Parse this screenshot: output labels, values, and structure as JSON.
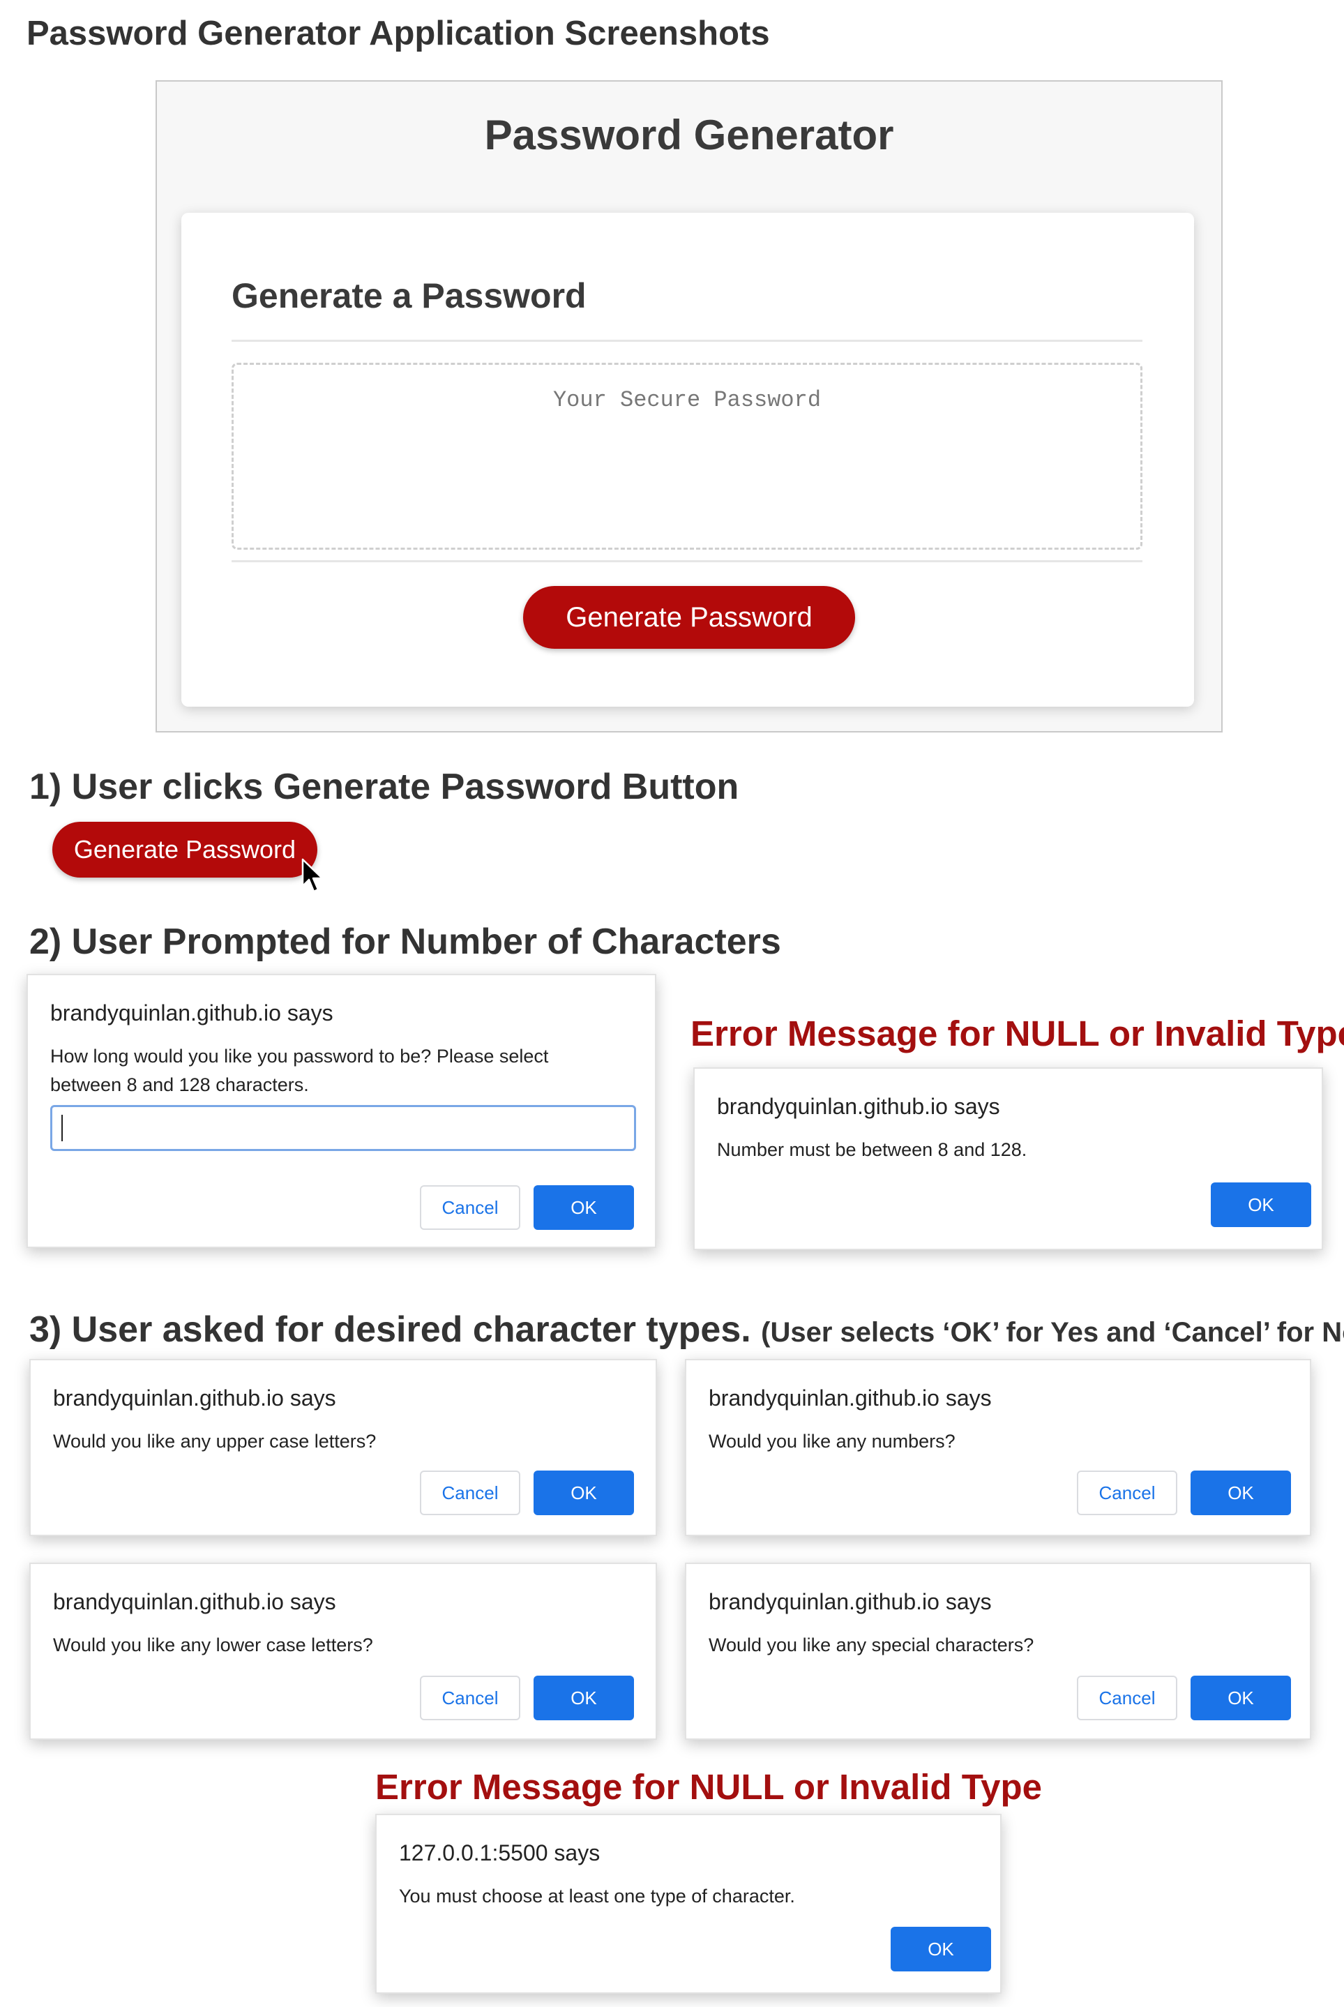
{
  "page_title": "Password Generator Application Screenshots",
  "app": {
    "title": "Password Generator",
    "card_heading": "Generate a Password",
    "password_placeholder": "Your Secure Password",
    "generate_button": "Generate Password"
  },
  "step1": {
    "heading": "1) User clicks Generate Password Button",
    "button_label": "Generate Password"
  },
  "step2": {
    "heading": "2) User Prompted for Number of Characters",
    "prompt_dialog": {
      "title": "brandyquinlan.github.io says",
      "message": "How long would you like you password to be? Please select between 8 and 128 characters.",
      "input_value": "",
      "cancel_label": "Cancel",
      "ok_label": "OK"
    },
    "error_heading": "Error Message for NULL or Invalid Type",
    "error_dialog": {
      "title": "brandyquinlan.github.io says",
      "message": "Number must be between 8 and 128.",
      "ok_label": "OK"
    }
  },
  "step3": {
    "heading": "3) User asked for desired character types.",
    "note": "(User selects ‘OK’ for Yes and ‘Cancel’ for No)",
    "dialogs": [
      {
        "title": "brandyquinlan.github.io says",
        "message": "Would you like any upper case letters?",
        "cancel_label": "Cancel",
        "ok_label": "OK"
      },
      {
        "title": "brandyquinlan.github.io says",
        "message": "Would you like any numbers?",
        "cancel_label": "Cancel",
        "ok_label": "OK"
      },
      {
        "title": "brandyquinlan.github.io says",
        "message": "Would you like any lower case letters?",
        "cancel_label": "Cancel",
        "ok_label": "OK"
      },
      {
        "title": "brandyquinlan.github.io says",
        "message": "Would you like any special characters?",
        "cancel_label": "Cancel",
        "ok_label": "OK"
      }
    ],
    "error_heading": "Error Message for NULL or Invalid Type",
    "error_dialog": {
      "title": "127.0.0.1:5500 says",
      "message": "You must choose at least one type of character.",
      "ok_label": "OK"
    }
  },
  "colors": {
    "brand_red": "#b30a0a",
    "error_heading_red": "#a30f0f",
    "dialog_blue": "#1a73e8"
  },
  "icons": {
    "cursor": "mouse-pointer-icon"
  }
}
